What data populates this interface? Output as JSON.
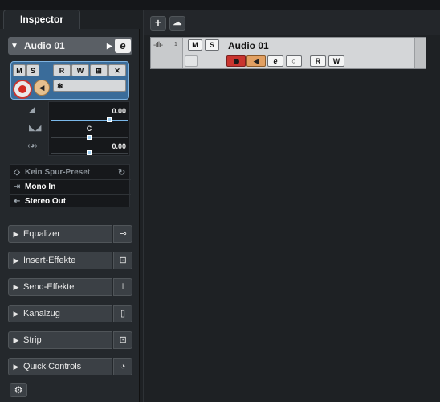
{
  "inspector": {
    "tab_label": "Inspector",
    "track": {
      "name": "Audio 01",
      "buttons": {
        "mute": "M",
        "solo": "S",
        "read": "R",
        "write": "W",
        "edit": "e"
      },
      "volume_value": "0.00",
      "pan_value": "C",
      "delay_value": "0.00"
    },
    "routing": {
      "preset": "Kein Spur-Preset",
      "input": "Mono In",
      "output": "Stereo Out"
    },
    "sections": [
      {
        "label": "Equalizer",
        "icon": "eq-icon"
      },
      {
        "label": "Insert-Effekte",
        "icon": "insert-icon"
      },
      {
        "label": "Send-Effekte",
        "icon": "send-icon"
      },
      {
        "label": "Kanalzug",
        "icon": "channel-strip-icon"
      },
      {
        "label": "Strip",
        "icon": "strip-icon"
      },
      {
        "label": "Quick Controls",
        "icon": "quick-controls-icon"
      }
    ]
  },
  "project": {
    "track_row": {
      "number": "1",
      "name": "Audio 01",
      "mute": "M",
      "solo": "S",
      "edit": "e",
      "read": "R",
      "write": "W"
    }
  },
  "colors": {
    "record": "#c9352f",
    "monitor": "#e2a062",
    "selected_control": "#3a6c9a"
  }
}
